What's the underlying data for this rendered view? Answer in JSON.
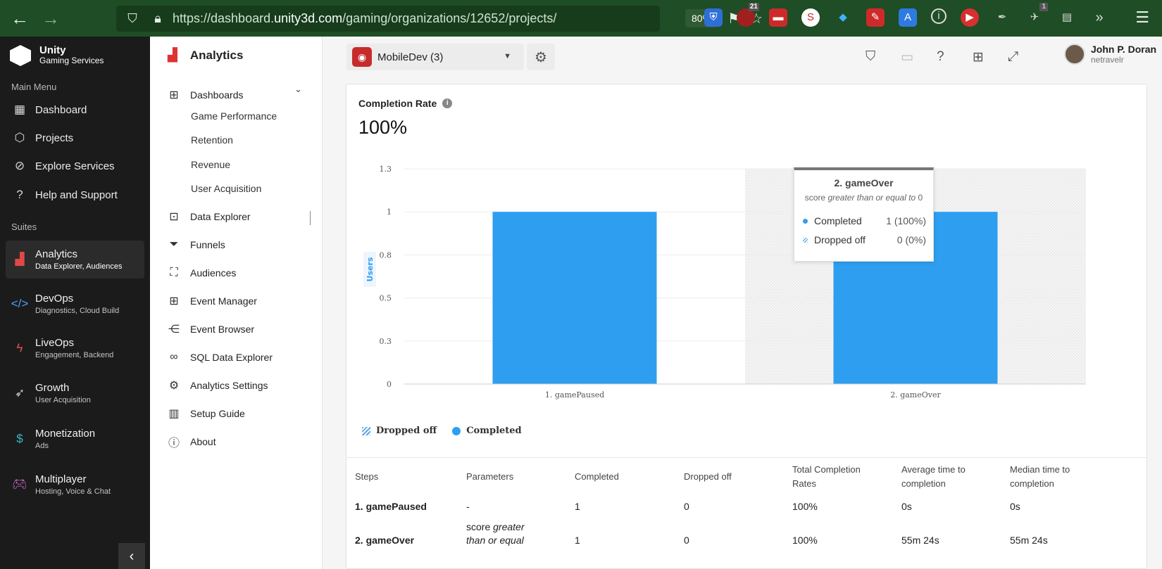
{
  "browser": {
    "url_prefix": "https://dashboard.",
    "url_domain": "unity3d.com",
    "url_rest": "/gaming/organizations/12652/projects/",
    "zoom": "80%",
    "ext_badge_1": "21",
    "ext_badge_2": "1"
  },
  "logo": {
    "title": "Unity",
    "subtitle": "Gaming Services"
  },
  "sidebar": {
    "main_menu_label": "Main Menu",
    "main_items": [
      {
        "label": "Dashboard",
        "icon": "dashboard-icon"
      },
      {
        "label": "Projects",
        "icon": "cube-icon"
      },
      {
        "label": "Explore Services",
        "icon": "compass-icon"
      },
      {
        "label": "Help and Support",
        "icon": "help-icon"
      }
    ],
    "suites_label": "Suites",
    "suites": [
      {
        "name": "Analytics",
        "sub": "Data Explorer, Audiences",
        "icon": "analytics-icon",
        "color": "#e04848"
      },
      {
        "name": "DevOps",
        "sub": "Diagnostics, Cloud Build",
        "icon": "code-icon",
        "color": "#4aa3ff"
      },
      {
        "name": "LiveOps",
        "sub": "Engagement, Backend",
        "icon": "bolt-icon",
        "color": "#e0564f"
      },
      {
        "name": "Growth",
        "sub": "User Acquisition",
        "icon": "rocket-icon",
        "color": "#cfcfcf"
      },
      {
        "name": "Monetization",
        "sub": "Ads",
        "icon": "dollar-icon",
        "color": "#39b7c9"
      },
      {
        "name": "Multiplayer",
        "sub": "Hosting, Voice & Chat",
        "icon": "gamepad-icon",
        "color": "#d86fd8"
      }
    ]
  },
  "subnav": {
    "title": "Analytics",
    "dashboards": "Dashboards",
    "children": [
      "Game Performance",
      "Retention",
      "Revenue",
      "User Acquisition"
    ],
    "items": [
      {
        "label": "Data Explorer",
        "icon": "presentation-icon"
      },
      {
        "label": "Funnels",
        "icon": "funnel-icon"
      },
      {
        "label": "Audiences",
        "icon": "audience-icon"
      },
      {
        "label": "Event Manager",
        "icon": "event-manager-icon"
      },
      {
        "label": "Event Browser",
        "icon": "share-icon"
      },
      {
        "label": "SQL Data Explorer",
        "icon": "binoculars-icon"
      },
      {
        "label": "Analytics Settings",
        "icon": "gear-icon"
      },
      {
        "label": "Setup Guide",
        "icon": "book-icon"
      },
      {
        "label": "About",
        "icon": "question-icon"
      }
    ]
  },
  "topbar": {
    "project": "MobileDev (3)",
    "user_name": "John P. Doran",
    "user_handle": "netravelr"
  },
  "card": {
    "title": "Completion Rate",
    "value": "100%"
  },
  "chart_data": {
    "type": "bar",
    "categories": [
      "1. gamePaused",
      "2. gameOver"
    ],
    "series": [
      {
        "name": "Completed",
        "values": [
          1,
          1
        ]
      },
      {
        "name": "Dropped off",
        "values": [
          0,
          0
        ]
      }
    ],
    "ylabel": "Users",
    "yticks": [
      "0",
      "0.3",
      "0.5",
      "0.8",
      "1",
      "1.3"
    ],
    "ytick_values": [
      0,
      0.25,
      0.5,
      0.75,
      1,
      1.25
    ],
    "ylim": [
      0,
      1.25
    ],
    "legend": [
      "Dropped off",
      "Completed"
    ],
    "legend_position": "bottom-left",
    "bar_color": "#2e9ef0",
    "highlighted_category": "2. gameOver",
    "tooltip": {
      "title": "2. gameOver",
      "subtitle_pre": "score ",
      "subtitle_italic": "greater than or equal to",
      "subtitle_post": " 0",
      "rows": [
        {
          "label": "Completed",
          "value": "1 (100%)"
        },
        {
          "label": "Dropped off",
          "value": "0 (0%)"
        }
      ]
    }
  },
  "table": {
    "headers": [
      "Steps",
      "Parameters",
      "Completed",
      "Dropped off",
      "Total Completion Rates",
      "Average time to completion",
      "Median time to completion"
    ],
    "rows": [
      {
        "step": "1. gamePaused",
        "param": "-",
        "param_italic": "",
        "completed": "1",
        "dropped": "0",
        "rate": "100%",
        "avg": "0s",
        "median": "0s"
      },
      {
        "step": "2. gameOver",
        "param": "score",
        "param_italic": "greater than or equal",
        "completed": "1",
        "dropped": "0",
        "rate": "100%",
        "avg": "55m 24s",
        "median": "55m 24s"
      }
    ]
  }
}
